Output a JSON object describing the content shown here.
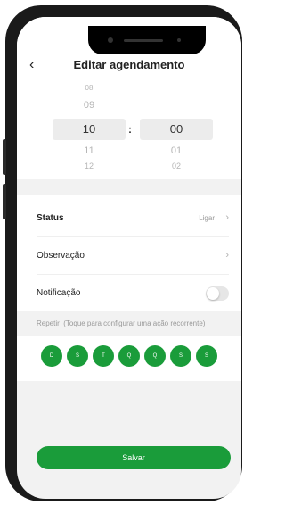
{
  "header": {
    "back_icon": "chevron-left-icon",
    "title": "Editar agendamento"
  },
  "time_picker": {
    "hours": [
      "08",
      "09",
      "10",
      "11",
      "12"
    ],
    "selected_hour": "10",
    "separator": ":",
    "minutes": [
      "",
      "",
      "00",
      "01",
      "02"
    ],
    "selected_minute": "00"
  },
  "settings": {
    "status": {
      "label": "Status",
      "value": "Ligar"
    },
    "observation": {
      "label": "Observação"
    },
    "notification": {
      "label": "Notificação",
      "enabled": false
    }
  },
  "repeat": {
    "label": "Repetir",
    "hint": "(Toque para configurar uma ação recorrente)",
    "days": [
      "D",
      "S",
      "T",
      "Q",
      "Q",
      "S",
      "S"
    ]
  },
  "save_label": "Salvar",
  "colors": {
    "accent": "#1a9c3a",
    "screen_bg": "#f2f2f2"
  }
}
